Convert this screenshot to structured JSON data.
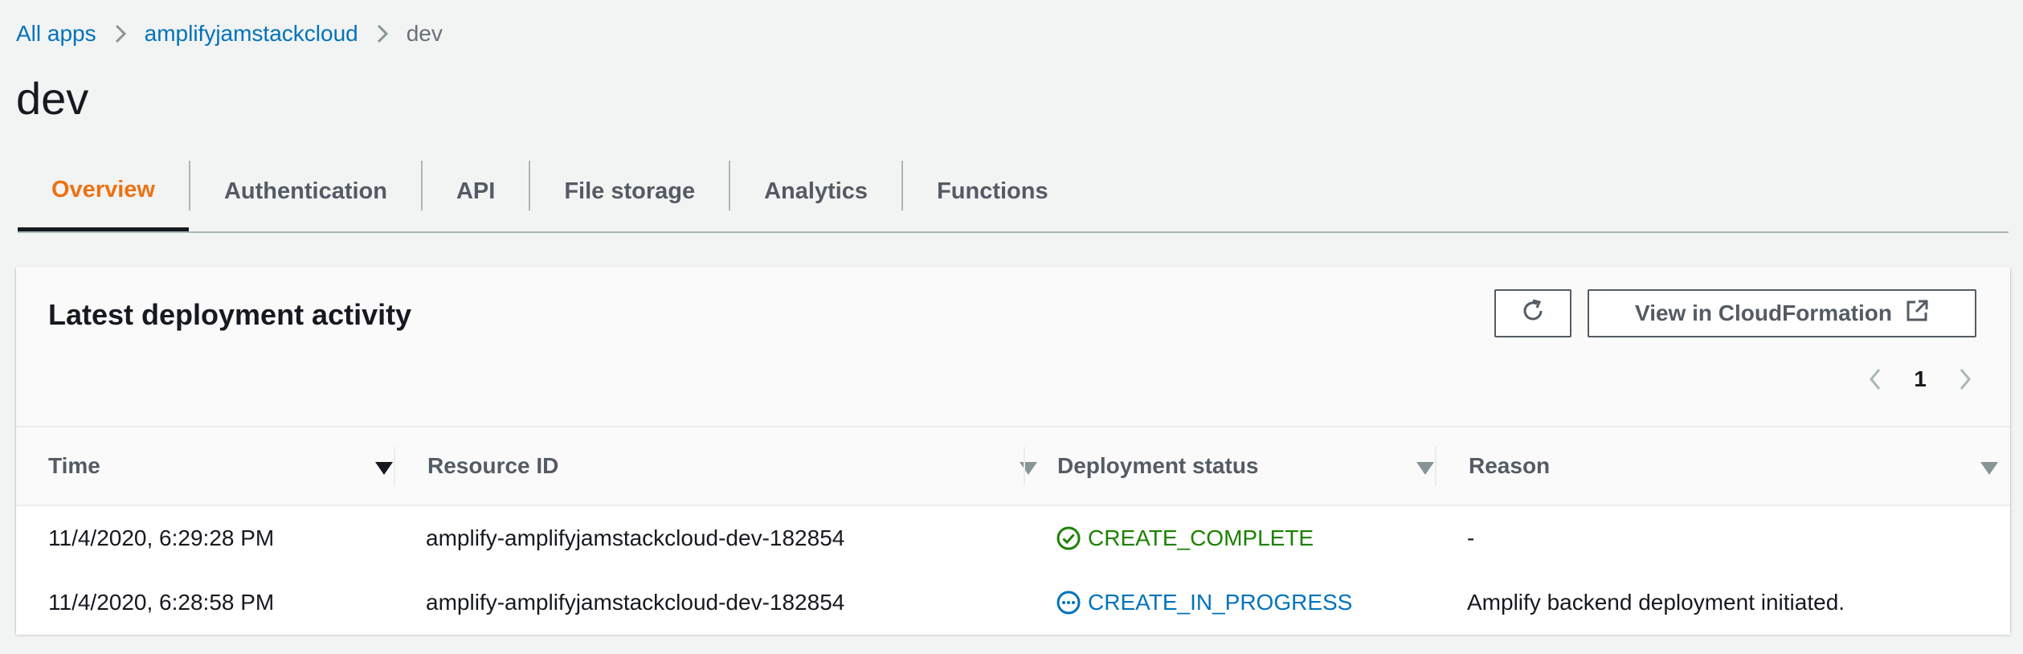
{
  "breadcrumb": {
    "items": [
      "All apps",
      "amplifyjamstackcloud",
      "dev"
    ]
  },
  "page": {
    "title": "dev"
  },
  "tabs": [
    {
      "label": "Overview",
      "active": true
    },
    {
      "label": "Authentication"
    },
    {
      "label": "API"
    },
    {
      "label": "File storage"
    },
    {
      "label": "Analytics"
    },
    {
      "label": "Functions"
    }
  ],
  "panel": {
    "title": "Latest deployment activity",
    "refresh_icon": "refresh-icon",
    "view_cfn_label": "View in CloudFormation",
    "external_icon": "external-link-icon",
    "pagination": {
      "current_page": "1"
    }
  },
  "table": {
    "columns": [
      "Time",
      "Resource ID",
      "Deployment status",
      "Reason"
    ],
    "rows": [
      {
        "time": "11/4/2020, 6:29:28 PM",
        "resource_id": "amplify-amplifyjamstackcloud-dev-182854",
        "status": "CREATE_COMPLETE",
        "status_icon": "check-circle-icon",
        "reason": "-"
      },
      {
        "time": "11/4/2020, 6:28:58 PM",
        "resource_id": "amplify-amplifyjamstackcloud-dev-182854",
        "status": "CREATE_IN_PROGRESS",
        "status_icon": "in-progress-icon",
        "reason": "Amplify backend deployment initiated."
      }
    ]
  },
  "colors": {
    "link": "#0073bb",
    "active_tab": "#ec7211",
    "success": "#1d8102",
    "in_progress": "#0073bb",
    "background": "#f2f3f3"
  }
}
